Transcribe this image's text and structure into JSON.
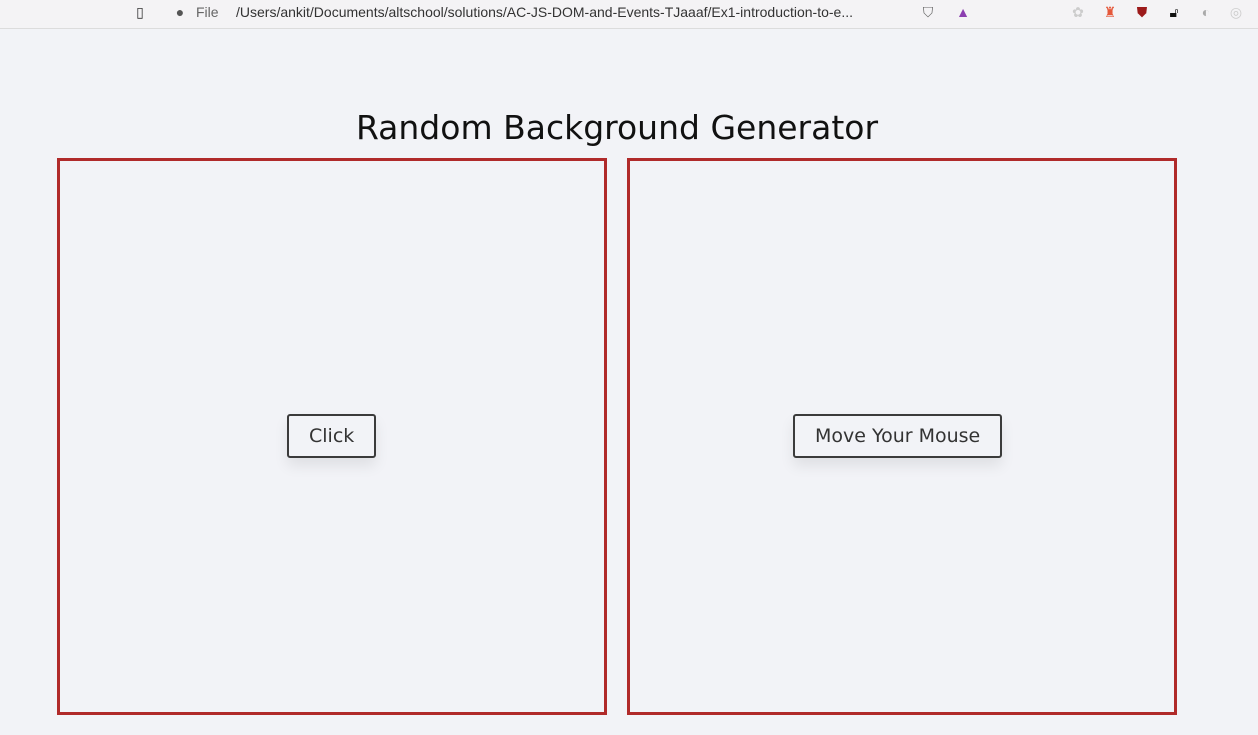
{
  "browser": {
    "scheme": "File",
    "url": "/Users/ankit/Documents/altschool/solutions/AC-JS-DOM-and-Events-TJaaaf/Ex1-introduction-to-e..."
  },
  "page": {
    "title": "Random Background Generator",
    "click_label": "Click",
    "mouse_label": "Move Your Mouse"
  },
  "colors": {
    "border": "#b02a2a",
    "background": "#f2f3f7"
  }
}
